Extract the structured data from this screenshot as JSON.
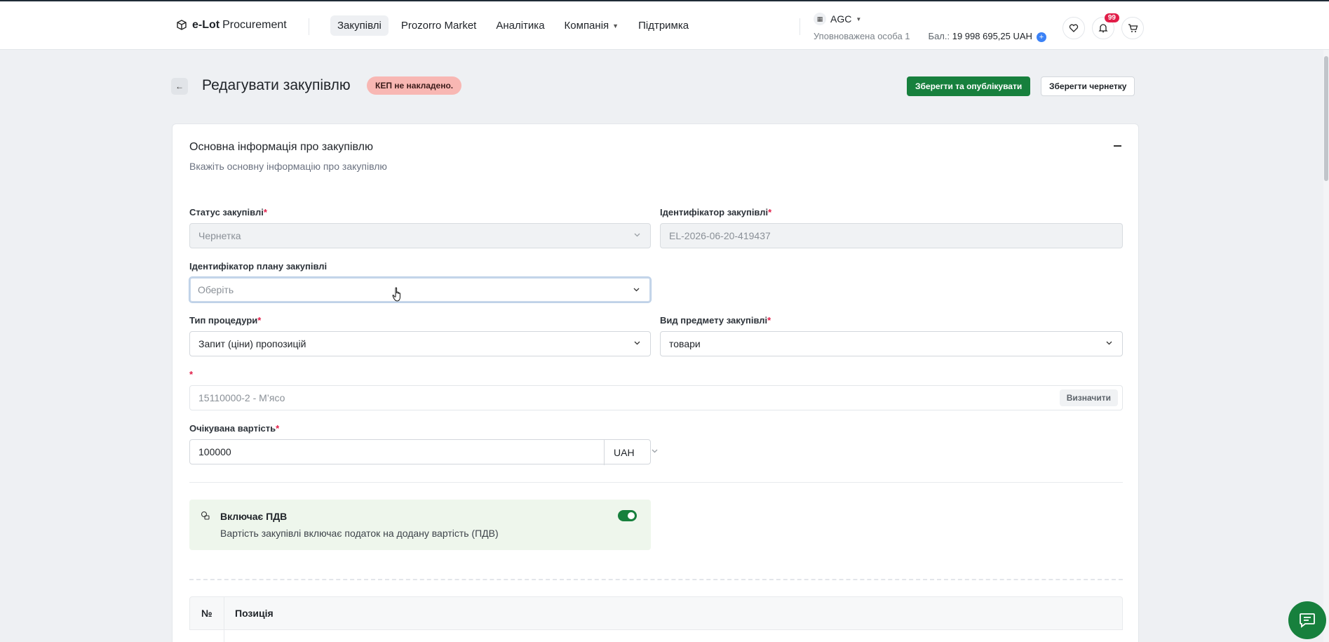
{
  "header": {
    "logo_bold": "e-Lot",
    "logo_rest": "Procurement",
    "nav": [
      {
        "label": "Закупівлі",
        "active": true
      },
      {
        "label": "Prozorro Market"
      },
      {
        "label": "Аналітика"
      },
      {
        "label": "Компанія",
        "dropdown": true
      },
      {
        "label": "Підтримка"
      }
    ],
    "org": {
      "name": "AGC",
      "role": "Уповноважена особа 1",
      "balance_label": "Бал.:",
      "balance_value": "19 998 695,25 UAH"
    },
    "notifications_count": "99",
    "icons": [
      "heart-icon",
      "bell-icon",
      "cart-icon"
    ]
  },
  "page": {
    "title": "Редагувати закупівлю",
    "kep_badge": "КЕП не накладено.",
    "publish_button": "Зберегти та опублікувати",
    "draft_button": "Зберегти чернетку"
  },
  "section": {
    "title": "Основна інформація про закупівлю",
    "subtitle": "Вкажіть основну інформацію про закупівлю"
  },
  "form": {
    "status": {
      "label": "Статус закупівлі",
      "value": "Чернетка"
    },
    "identifier": {
      "label": "Ідентифікатор закупівлі",
      "value": "EL-2026-06-20-419437"
    },
    "plan_id": {
      "label": "Ідентифікатор плану закупівлі",
      "placeholder": "Оберіть"
    },
    "procedure_type": {
      "label": "Тип процедури",
      "value": "Запит (ціни) пропозицій"
    },
    "subject_type": {
      "label": "Вид предмету закупівлі",
      "value": "товари"
    },
    "cpv": {
      "label": "",
      "value": "15110000-2 - М’ясо",
      "button": "Визначити"
    },
    "expected_value": {
      "label": "Очікувана вартість",
      "value": "100000",
      "currency": "UAH"
    },
    "required_mark": "*"
  },
  "vat": {
    "title": "Включає ПДВ",
    "subtitle": "Вартість закупівлі включає податок на додану вартість (ПДВ)",
    "enabled": true
  },
  "table": {
    "headers": [
      "№",
      "Позиція"
    ]
  },
  "colors": {
    "accent": "#17803d",
    "badge_bg": "#f8b7b3",
    "notify": "#e11d48"
  }
}
